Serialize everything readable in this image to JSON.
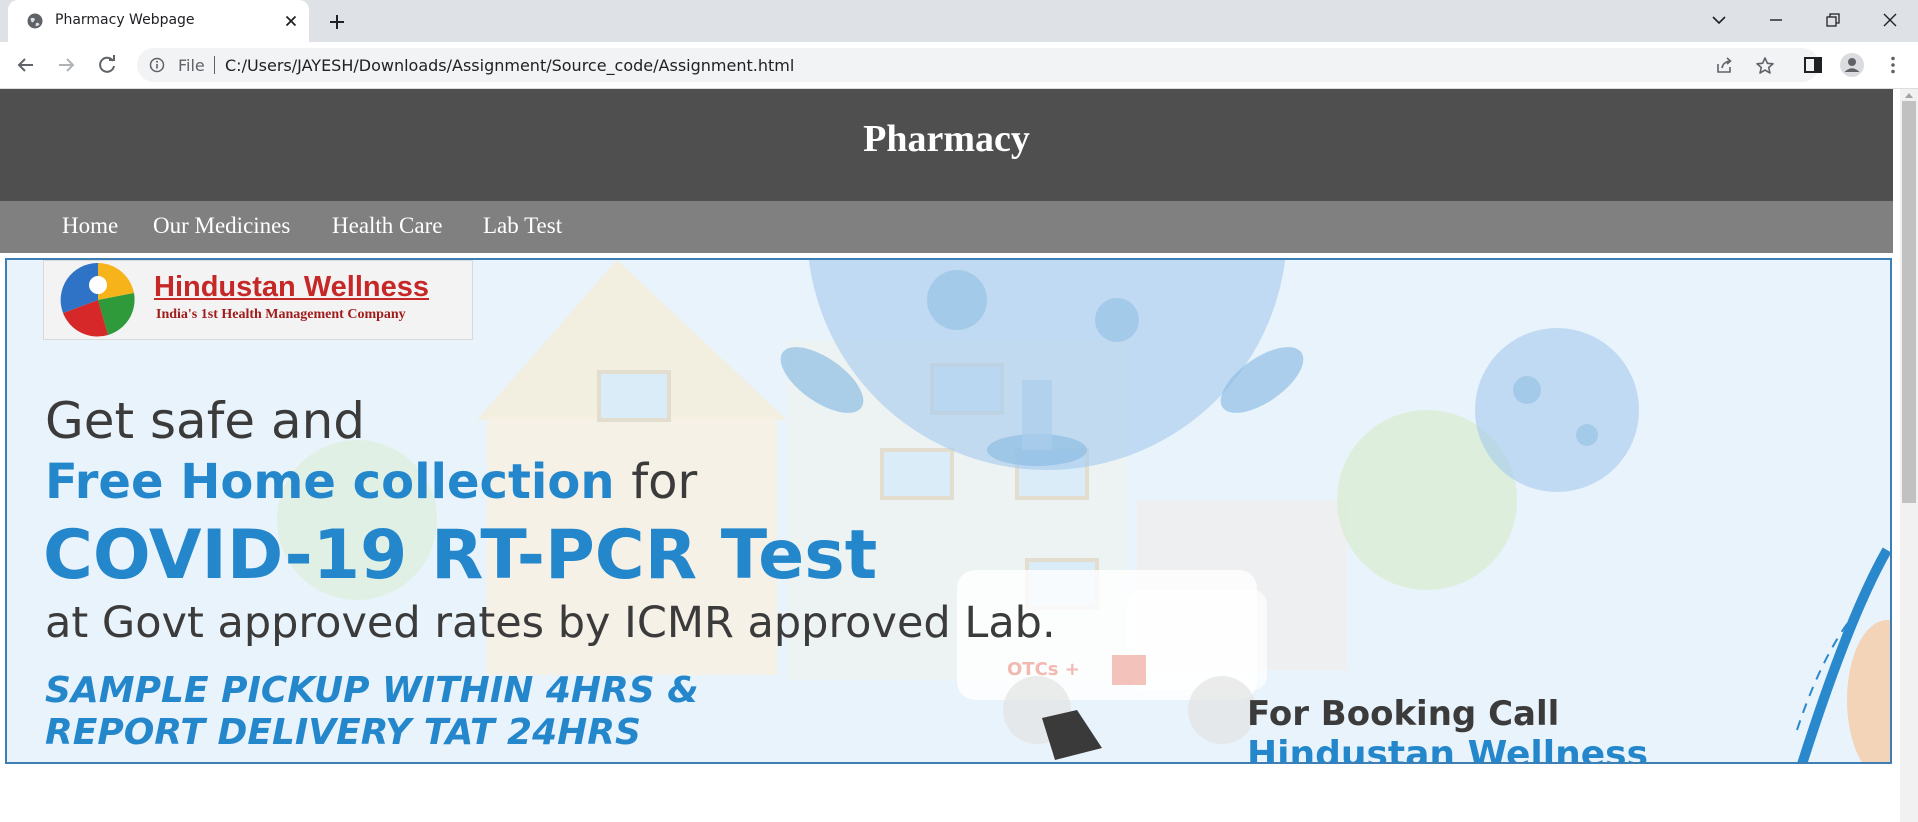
{
  "browser": {
    "tab_title": "Pharmacy Webpage",
    "omnibox_file_label": "File",
    "url": "C:/Users/JAYESH/Downloads/Assignment/Source_code/Assignment.html"
  },
  "site": {
    "title": "Pharmacy",
    "nav": [
      "Home",
      "Our Medicines",
      "Health Care",
      "Lab Test"
    ]
  },
  "banner": {
    "logo_name": "Hindustan Wellness",
    "logo_tagline": "India's 1st Health Management Company",
    "line1": "Get safe and",
    "line2_highlight": "Free Home collection",
    "line2_rest": "for",
    "line3": "COVID-19 RT-PCR Test",
    "line4": "at Govt approved rates by ICMR approved Lab.",
    "line5": "SAMPLE PICKUP WITHIN 4HRS &",
    "line6": "REPORT DELIVERY TAT 24HRS",
    "booking_label": "For Booking Call",
    "booking_name": "Hindustan Wellness",
    "van_text": "OTCs +"
  },
  "colors": {
    "header_bg": "#4f4f4f",
    "nav_bg": "#808080",
    "banner_border": "#3d7fb5",
    "banner_blue": "#2487cc"
  }
}
